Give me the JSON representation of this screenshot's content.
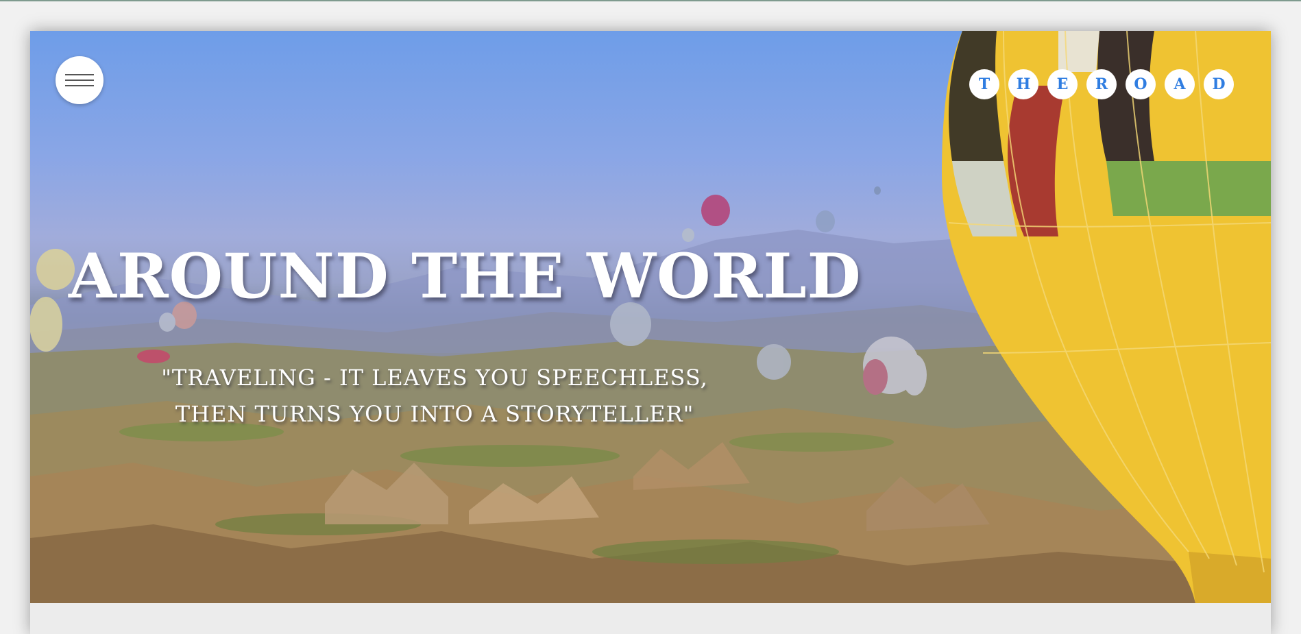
{
  "hero": {
    "title": "AROUND THE WORLD",
    "quote_line1": "\"TRAVELING - IT LEAVES YOU SPEECHLESS,",
    "quote_line2": "THEN TURNS YOU INTO A STORYTELLER\""
  },
  "logo": {
    "letters": [
      "T",
      "H",
      "E",
      "R",
      "O",
      "A",
      "D"
    ]
  },
  "icons": {
    "menu": "hamburger-menu-icon"
  },
  "colors": {
    "logo_text": "#2f7de1",
    "sky_top": "#6e9de8",
    "balloon_yellow": "#f0c332"
  }
}
